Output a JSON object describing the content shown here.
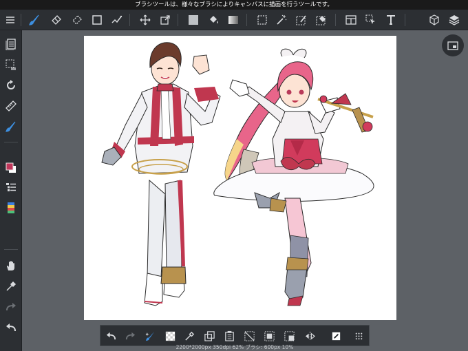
{
  "status_message": "ブラシツールは、様々なブラシによりキャンバスに描画を行うツールです。",
  "info_text": "2200*2000px 350dpi 62% ブラシ: 600px 10%",
  "accent_color": "#3d8fe0",
  "top_tools": [
    "menu-icon",
    "brush-icon",
    "eraser-icon",
    "blur-eraser-icon",
    "shape-icon",
    "dot-icon",
    "move-icon",
    "transform-icon",
    "fill-color-icon",
    "bucket-icon",
    "gradient-icon",
    "select-icon",
    "magic-wand-icon",
    "select-pen-icon",
    "select-eraser-icon",
    "panel-icon",
    "select-move-icon",
    "text-icon",
    "material-icon",
    "layer-icon"
  ],
  "left_tools": [
    "page-icon",
    "selection-icon",
    "rotate-icon",
    "ruler-icon",
    "brush-settings-icon",
    "color-icon",
    "layer-list-icon",
    "palette-icon",
    "hand-icon",
    "eyedropper-icon",
    "redo-icon",
    "undo-icon"
  ],
  "bottom_tools": [
    "undo-icon",
    "redo-icon",
    "snap-icon",
    "transparent-icon",
    "eyedropper-icon",
    "copy-icon",
    "paste-icon",
    "deselect-icon",
    "select-all-icon",
    "invert-select-icon",
    "flip-icon",
    "fill-icon",
    "more-icon"
  ]
}
